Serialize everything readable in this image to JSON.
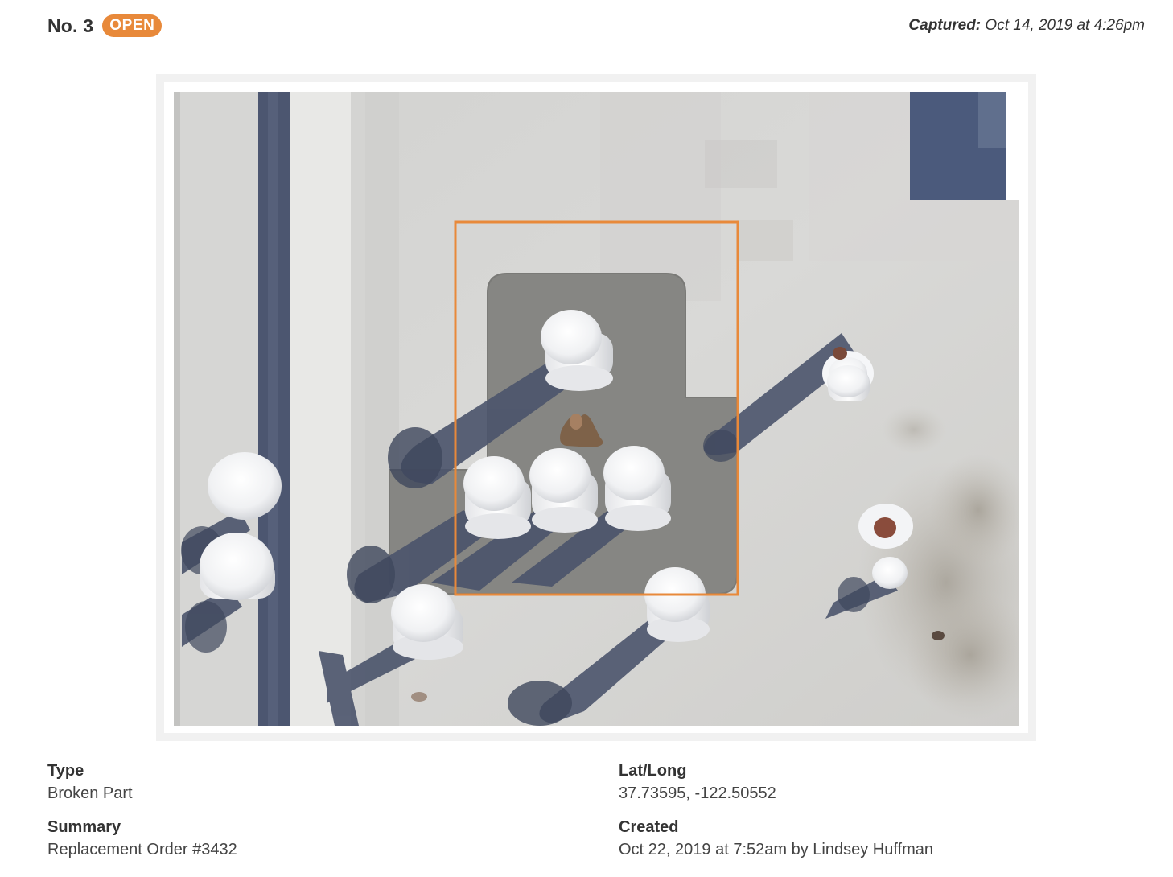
{
  "header": {
    "issue_number": "No. 3",
    "status": "OPEN",
    "captured_label": "Captured:",
    "captured_value": " Oct 14, 2019 at 4:26pm"
  },
  "photo": {
    "annotation_icon": "bounding-box",
    "annotation_color": "#e8893a"
  },
  "details": {
    "type": {
      "label": "Type",
      "value": "Broken Part"
    },
    "summary": {
      "label": "Summary",
      "value": "Replacement Order #3432"
    },
    "latlong": {
      "label": "Lat/Long",
      "value": "37.73595, -122.50552"
    },
    "created": {
      "label": "Created",
      "value": "Oct 22, 2019 at 7:52am by Lindsey Huffman"
    }
  },
  "colors": {
    "accent": "#e8893a",
    "text": "#333333",
    "frame": "#f1f1f1"
  }
}
